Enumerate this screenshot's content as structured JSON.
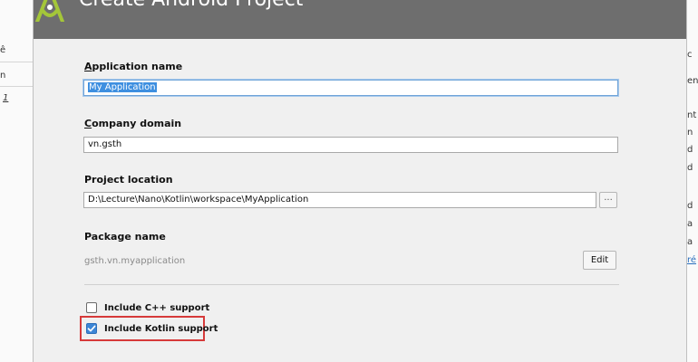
{
  "dialog": {
    "title": "Create Android Project",
    "accent_color": "#6e6e6e"
  },
  "form": {
    "app_name_label_u": "A",
    "app_name_label_rest": "pplication name",
    "app_name_value": "My Application",
    "company_domain_label_u": "C",
    "company_domain_label_rest": "ompany domain",
    "company_domain_value": "vn.gsth",
    "project_location_label": "Project location",
    "project_location_value": "D:\\Lecture\\Nano\\Kotlin\\workspace\\MyApplication",
    "browse_label": "...",
    "package_name_label": "Package name",
    "package_name_value": "gsth.vn.myapplication",
    "edit_label": "Edit"
  },
  "options": {
    "cpp_label": "Include C++ support",
    "cpp_checked": false,
    "kotlin_label": "Include Kotlin support",
    "kotlin_checked": true,
    "highlight_color": "#d63a3a"
  },
  "background_fragments": {
    "left": [
      "ê",
      "n",
      "1"
    ],
    "right": [
      "c",
      "en",
      "nt",
      "n",
      "d",
      "d",
      "d",
      "a",
      "a",
      "ré"
    ]
  }
}
